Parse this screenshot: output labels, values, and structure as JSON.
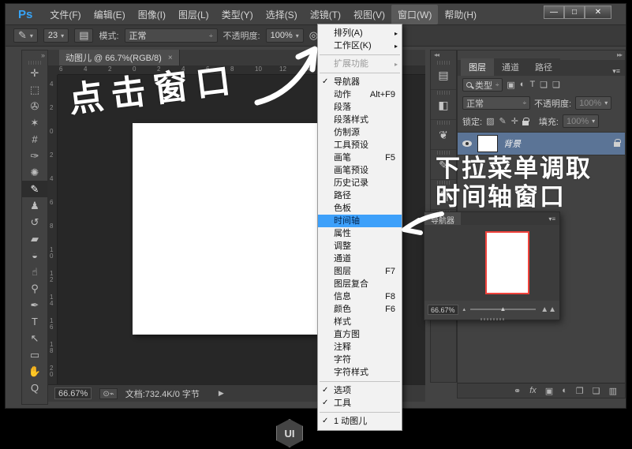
{
  "titlebar": {
    "logo": "Ps",
    "menus": [
      {
        "label": "文件(F)",
        "active": false
      },
      {
        "label": "编辑(E)",
        "active": false
      },
      {
        "label": "图像(I)",
        "active": false
      },
      {
        "label": "图层(L)",
        "active": false
      },
      {
        "label": "类型(Y)",
        "active": false
      },
      {
        "label": "选择(S)",
        "active": false
      },
      {
        "label": "滤镜(T)",
        "active": false
      },
      {
        "label": "视图(V)",
        "active": false
      },
      {
        "label": "窗口(W)",
        "active": true
      },
      {
        "label": "帮助(H)",
        "active": false
      }
    ],
    "window_controls": {
      "minimize": "—",
      "maximize": "□",
      "close": "✕"
    }
  },
  "options_bar": {
    "tool_glyph": "✎",
    "brush_size": "23",
    "toggle_panel_glyph": "▤",
    "mode_label": "模式:",
    "mode_value": "正常",
    "opacity_label": "不透明度:",
    "opacity_value": "100%",
    "airbrush_glyph": "◎"
  },
  "document_tab": {
    "title": "动图儿 @ 66.7%(RGB/8)",
    "close": "×"
  },
  "toolbar": {
    "header": "»",
    "tools": [
      {
        "name": "move-tool",
        "glyph": "✛",
        "selected": false
      },
      {
        "name": "marquee-tool",
        "glyph": "⬚",
        "selected": false
      },
      {
        "name": "lasso-tool",
        "glyph": "✇",
        "selected": false
      },
      {
        "name": "magic-wand-tool",
        "glyph": "✶",
        "selected": false
      },
      {
        "name": "crop-tool",
        "glyph": "#",
        "selected": false
      },
      {
        "name": "eyedropper-tool",
        "glyph": "✑",
        "selected": false
      },
      {
        "name": "healing-brush-tool",
        "glyph": "✺",
        "selected": false
      },
      {
        "name": "brush-tool",
        "glyph": "✎",
        "selected": true
      },
      {
        "name": "clone-stamp-tool",
        "glyph": "♟",
        "selected": false
      },
      {
        "name": "history-brush-tool",
        "glyph": "↺",
        "selected": false
      },
      {
        "name": "eraser-tool",
        "glyph": "▰",
        "selected": false
      },
      {
        "name": "gradient-tool",
        "glyph": "◒",
        "selected": false
      },
      {
        "name": "smudge-tool",
        "glyph": "☝",
        "selected": false
      },
      {
        "name": "dodge-tool",
        "glyph": "⚲",
        "selected": false
      },
      {
        "name": "pen-tool",
        "glyph": "✒",
        "selected": false
      },
      {
        "name": "type-tool",
        "glyph": "T",
        "selected": false
      },
      {
        "name": "path-select-tool",
        "glyph": "↖",
        "selected": false
      },
      {
        "name": "shape-tool",
        "glyph": "▭",
        "selected": false
      },
      {
        "name": "hand-tool",
        "glyph": "✋",
        "selected": false
      },
      {
        "name": "zoom-tool",
        "glyph": "Q",
        "selected": false
      }
    ]
  },
  "rulers": {
    "horizontal": [
      "6",
      "4",
      "2",
      "0",
      "2",
      "4",
      "6",
      "8",
      "10",
      "12",
      "14"
    ],
    "vertical": [
      "4",
      "2",
      "0",
      "2",
      "4",
      "6",
      "8",
      "10",
      "12",
      "14",
      "16",
      "18",
      "20"
    ]
  },
  "window_menu": {
    "items": [
      {
        "label": "排列(A)",
        "submenu": true
      },
      {
        "label": "工作区(K)",
        "submenu": true
      },
      {
        "type": "separator"
      },
      {
        "label": "扩展功能",
        "submenu": true,
        "disabled": true
      },
      {
        "type": "separator"
      },
      {
        "label": "导航器",
        "checked": true
      },
      {
        "label": "动作",
        "shortcut": "Alt+F9"
      },
      {
        "label": "段落"
      },
      {
        "label": "段落样式"
      },
      {
        "label": "仿制源"
      },
      {
        "label": "工具预设"
      },
      {
        "label": "画笔",
        "shortcut": "F5"
      },
      {
        "label": "画笔预设"
      },
      {
        "label": "历史记录"
      },
      {
        "label": "路径"
      },
      {
        "label": "色板"
      },
      {
        "label": "时间轴",
        "highlighted": true
      },
      {
        "label": "属性"
      },
      {
        "label": "调整"
      },
      {
        "label": "通道"
      },
      {
        "label": "图层",
        "shortcut": "F7"
      },
      {
        "label": "图层复合"
      },
      {
        "label": "信息",
        "shortcut": "F8"
      },
      {
        "label": "颜色",
        "shortcut": "F6"
      },
      {
        "label": "样式"
      },
      {
        "label": "直方图"
      },
      {
        "label": "注释"
      },
      {
        "label": "字符"
      },
      {
        "label": "字符样式"
      },
      {
        "type": "separator"
      },
      {
        "label": "选项",
        "checked": true
      },
      {
        "label": "工具",
        "checked": true
      },
      {
        "type": "separator"
      },
      {
        "label": "1 动图儿",
        "checked": true
      }
    ]
  },
  "icon_strip": {
    "header": "◂◂",
    "icons": [
      {
        "name": "history-panel-icon",
        "glyph": "▤"
      },
      {
        "name": "adjustments-panel-icon",
        "glyph": "◧"
      },
      {
        "name": "brush-presets-panel-icon",
        "glyph": "❦"
      },
      {
        "name": "brush-panel-icon",
        "glyph": "✎"
      },
      {
        "name": "character-panel-icon",
        "glyph": "A|"
      },
      {
        "name": "paragraph-panel-icon",
        "glyph": "¶"
      }
    ]
  },
  "layers_panel": {
    "header": "▸▸",
    "tabs": [
      "图层",
      "通道",
      "路径"
    ],
    "panel_menu_glyph": "▾≡",
    "filter_label": "类型",
    "filter_caret": "÷",
    "filter_icons": [
      {
        "name": "filter-pixel-icon",
        "glyph": "▣"
      },
      {
        "name": "filter-adjustment-icon",
        "glyph": "◐"
      },
      {
        "name": "filter-type-icon",
        "glyph": "T"
      },
      {
        "name": "filter-shape-icon",
        "glyph": "❏"
      },
      {
        "name": "filter-smart-icon",
        "glyph": "❑"
      }
    ],
    "blend_mode": "正常",
    "opacity_label": "不透明度:",
    "opacity_value": "100%",
    "lock_label": "锁定:",
    "lock_icons": [
      {
        "name": "lock-transparent-icon",
        "glyph": "▨"
      },
      {
        "name": "lock-paint-icon",
        "glyph": "✎"
      },
      {
        "name": "lock-move-icon",
        "glyph": "✛"
      }
    ],
    "fill_label": "填充:",
    "fill_value": "100%",
    "layer": {
      "name": "背景"
    },
    "bottom_icons": [
      {
        "name": "link-layers-icon",
        "glyph": "⚭"
      },
      {
        "name": "layer-style-icon",
        "glyph": "fx"
      },
      {
        "name": "layer-mask-icon",
        "glyph": "▣"
      },
      {
        "name": "adjustment-layer-icon",
        "glyph": "◐"
      },
      {
        "name": "layer-group-icon",
        "glyph": "❐"
      },
      {
        "name": "new-layer-icon",
        "glyph": "❏"
      },
      {
        "name": "delete-layer-icon",
        "glyph": "▥"
      }
    ]
  },
  "navigator": {
    "title": "导航器",
    "panel_menu_glyph": "▾≡",
    "zoom": "66.67%",
    "zoom_out_glyph": "▴",
    "slider_thumb_glyph": "▲",
    "zoom_in_glyph": "▲▲"
  },
  "status_bar": {
    "zoom": "66.67%",
    "icon_glyph": "⊙⌁",
    "doc_info": "文档:732.4K/0 字节",
    "arrow": "▶"
  },
  "annotations": {
    "note1": "点击窗口",
    "note2_line1": "下拉菜单调取",
    "note2_line2": "时间轴窗口"
  },
  "watermark": "UI",
  "colors": {
    "menu_highlight": "#3da0fa",
    "selected_layer": "#5b7496",
    "navigator_border": "#f0433c",
    "ps_logo": "#37a3f5",
    "annotation": "#ffffff"
  }
}
